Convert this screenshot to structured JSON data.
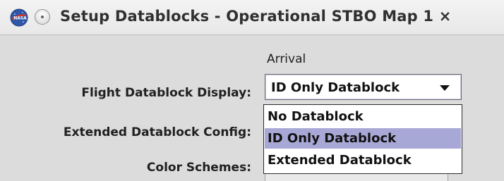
{
  "window": {
    "title": "Setup Datablocks - Operational STBO Map 1 ×",
    "app_icon": "nasa-logo-icon",
    "control_icon": "window-menu-circle-icon"
  },
  "table": {
    "column_header": "Arrival"
  },
  "rows": {
    "flight_datablock_display": "Flight Datablock Display:",
    "extended_datablock_config": "Extended Datablock Config:",
    "color_schemes": "Color Schemes:"
  },
  "flight_datablock_select": {
    "value": "ID Only Datablock",
    "arrow_icon": "chevron-down-icon",
    "options": [
      {
        "label": "No Datablock",
        "selected": false
      },
      {
        "label": "ID Only Datablock",
        "selected": true
      },
      {
        "label": "Extended Datablock",
        "selected": false
      }
    ]
  },
  "colors": {
    "background": "#dcdcdc",
    "selection": "#a8a8d6",
    "text": "#111111"
  }
}
